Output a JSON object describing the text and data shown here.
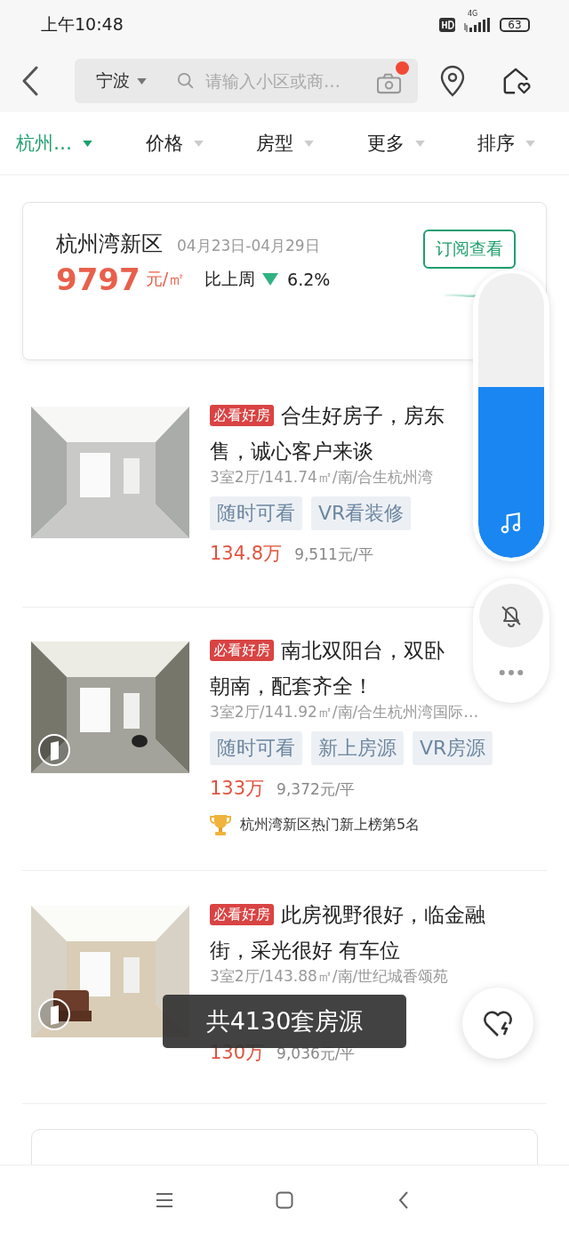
{
  "status_bar": {
    "time": "上午10:48",
    "network": "4G",
    "battery": "63"
  },
  "header": {
    "city": "宁波",
    "search_placeholder": "请输入小区或商…"
  },
  "filters": [
    {
      "label": "杭州…",
      "selected": true
    },
    {
      "label": "价格",
      "selected": false
    },
    {
      "label": "房型",
      "selected": false
    },
    {
      "label": "更多",
      "selected": false
    },
    {
      "label": "排序",
      "selected": false
    }
  ],
  "region_card": {
    "name": "杭州湾新区",
    "date_range": "04月23日-04月29日",
    "price": "9797",
    "unit": "元/㎡",
    "compare_label": "比上周",
    "trend_down": true,
    "change": "6.2%",
    "subscribe_button": "订阅查看"
  },
  "listings": [
    {
      "picture": {
        "kind": "picture"
      },
      "vr": false,
      "badge": "必看好房",
      "title_lines": [
        "合生好房子，房东",
        "售，诚心客户来谈"
      ],
      "details": "3室2厅/141.74㎡/南/合生杭州湾",
      "tags": [
        "随时可看",
        "VR看装修"
      ],
      "price": "134.8万",
      "unit_price": "9,511元/平"
    },
    {
      "picture": {
        "kind": "picture"
      },
      "vr": true,
      "badge": "必看好房",
      "title_lines": [
        "南北双阳台，双卧",
        "朝南，配套齐全！"
      ],
      "details": "3室2厅/141.92㎡/南/合生杭州湾国际…",
      "tags": [
        "随时可看",
        "新上房源",
        "VR房源"
      ],
      "price": "133万",
      "unit_price": "9,372元/平",
      "ranking": "杭州湾新区热门新上榜第5名"
    },
    {
      "picture": {
        "kind": "picture"
      },
      "vr": true,
      "badge": "必看好房",
      "title_lines": [
        "此房视野很好，临金融",
        "街，采光很好 有车位"
      ],
      "details": "3室2厅/143.88㎡/南/世纪城香颂苑",
      "price": "130万",
      "unit_price": "9,036元/平"
    }
  ],
  "volume": {
    "level": 0.6
  },
  "toast": "共4130套房源"
}
